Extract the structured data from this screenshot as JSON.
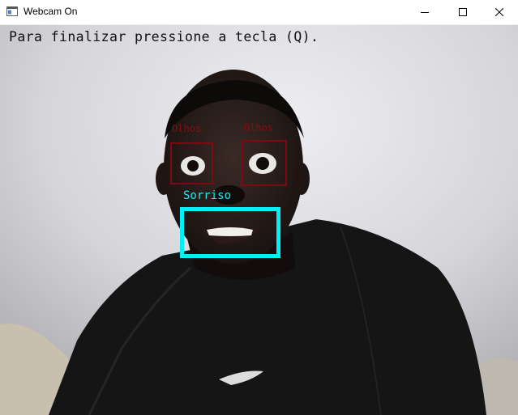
{
  "window": {
    "title": "Webcam On",
    "controls": {
      "minimize": "minimize-icon",
      "maximize": "maximize-icon",
      "close": "close-icon"
    }
  },
  "overlay": {
    "instruction": "Para finalizar pressione a tecla (Q).",
    "detections": [
      {
        "label": "Olhos",
        "kind": "eye"
      },
      {
        "label": "Olhos",
        "kind": "eye"
      },
      {
        "label": "Sorriso",
        "kind": "smile"
      }
    ]
  },
  "colors": {
    "eye_box": "#7d0a12",
    "smile_box": "#00f0f8",
    "instruction_text": "#101010"
  }
}
